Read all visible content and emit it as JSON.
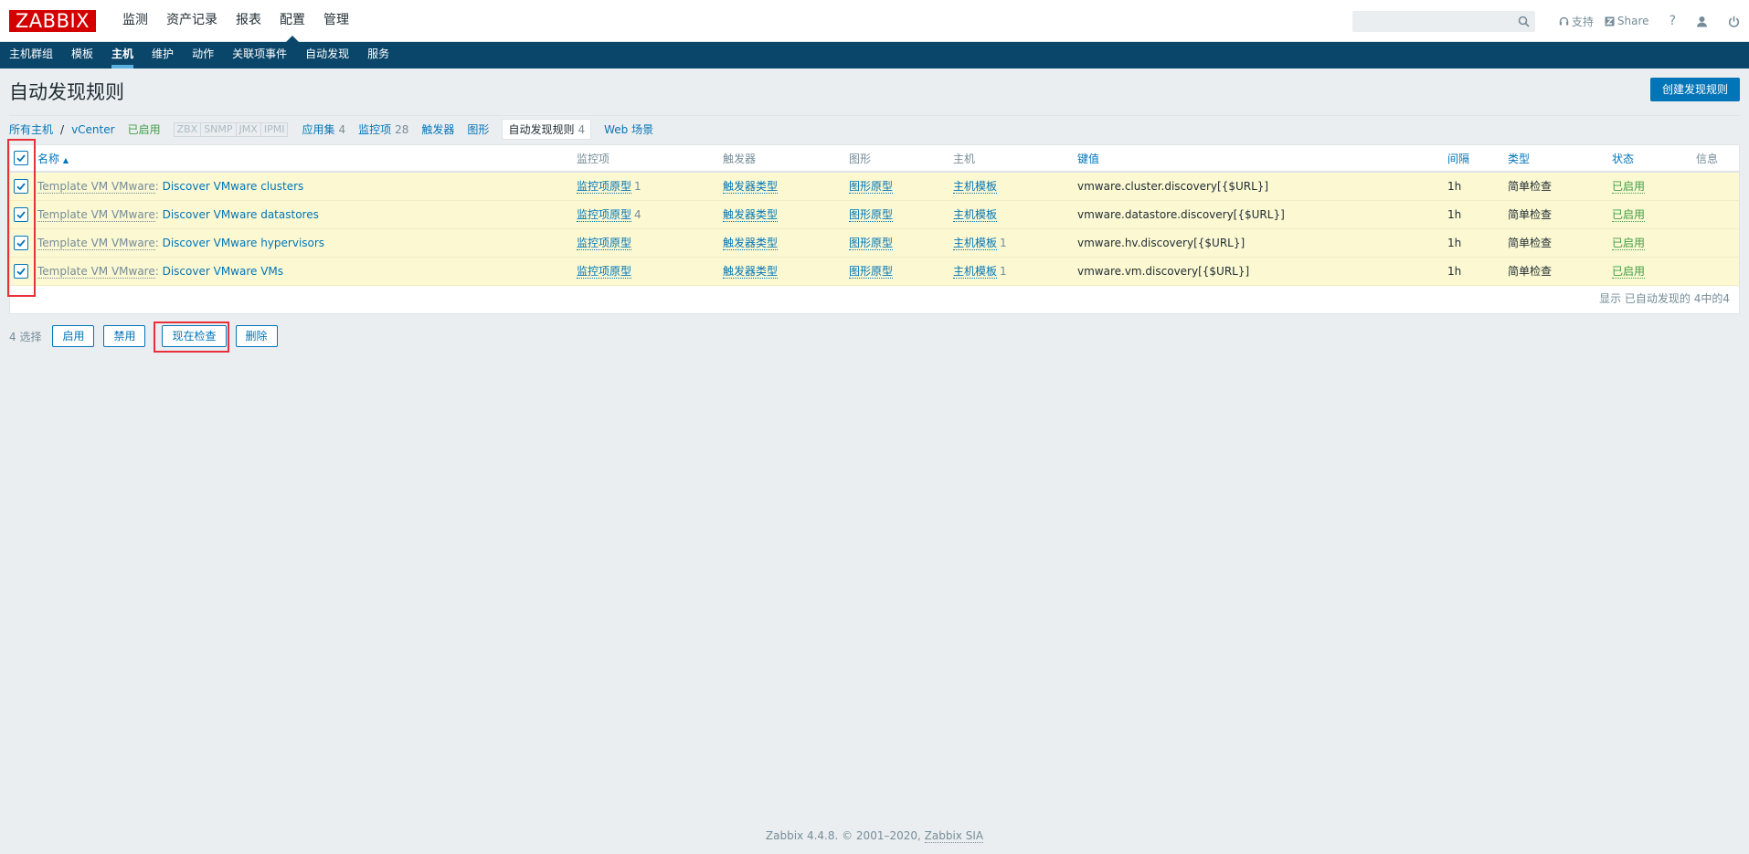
{
  "header": {
    "logo": "ZABBIX",
    "menu": [
      "监测",
      "资产记录",
      "报表",
      "配置",
      "管理"
    ],
    "active_menu": "配置",
    "support": "支持",
    "share": "Share",
    "help": "?"
  },
  "subnav": [
    "主机群组",
    "模板",
    "主机",
    "维护",
    "动作",
    "关联项事件",
    "自动发现",
    "服务"
  ],
  "page": {
    "title": "自动发现规则",
    "create_button": "创建发现规则"
  },
  "hostnav": {
    "all_hosts": "所有主机",
    "separator": "/",
    "host": "vCenter",
    "status": "已启用",
    "availability": [
      "ZBX",
      "SNMP",
      "JMX",
      "IPMI"
    ],
    "applications": "应用集",
    "applications_count": "4",
    "items": "监控项",
    "items_count": "28",
    "triggers": "触发器",
    "graphs": "图形",
    "discovery": "自动发现规则",
    "discovery_count": "4",
    "web": "Web 场景"
  },
  "table": {
    "headers": {
      "name": "名称",
      "sort_arrow": "▲",
      "items": "监控项",
      "triggers": "触发器",
      "graphs": "图形",
      "hosts": "主机",
      "key": "键值",
      "interval": "间隔",
      "type": "类型",
      "status": "状态",
      "info": "信息"
    },
    "rows": [
      {
        "template": "Template VM VMware",
        "colon": ":",
        "name": "Discover VMware clusters",
        "items": "监控项原型",
        "items_count": "1",
        "triggers": "触发器类型",
        "graphs": "图形原型",
        "hosts": "主机模板",
        "hosts_count": "",
        "key": "vmware.cluster.discovery[{$URL}]",
        "interval": "1h",
        "type": "简单检查",
        "status": "已启用"
      },
      {
        "template": "Template VM VMware",
        "colon": ":",
        "name": "Discover VMware datastores",
        "items": "监控项原型",
        "items_count": "4",
        "triggers": "触发器类型",
        "graphs": "图形原型",
        "hosts": "主机模板",
        "hosts_count": "",
        "key": "vmware.datastore.discovery[{$URL}]",
        "interval": "1h",
        "type": "简单检查",
        "status": "已启用"
      },
      {
        "template": "Template VM VMware",
        "colon": ":",
        "name": "Discover VMware hypervisors",
        "items": "监控项原型",
        "items_count": "",
        "triggers": "触发器类型",
        "graphs": "图形原型",
        "hosts": "主机模板",
        "hosts_count": "1",
        "key": "vmware.hv.discovery[{$URL}]",
        "interval": "1h",
        "type": "简单检查",
        "status": "已启用"
      },
      {
        "template": "Template VM VMware",
        "colon": ":",
        "name": "Discover VMware VMs",
        "items": "监控项原型",
        "items_count": "",
        "triggers": "触发器类型",
        "graphs": "图形原型",
        "hosts": "主机模板",
        "hosts_count": "1",
        "key": "vmware.vm.discovery[{$URL}]",
        "interval": "1h",
        "type": "简单检查",
        "status": "已启用"
      }
    ],
    "footer": "显示 已自动发现的 4中的4"
  },
  "actions": {
    "selected": "4 选择",
    "enable": "启用",
    "disable": "禁用",
    "check_now": "现在检查",
    "delete": "删除"
  },
  "footer": {
    "text": "Zabbix 4.4.8. © 2001–2020,",
    "link": "Zabbix SIA"
  },
  "colors": {
    "brand": "#d40000",
    "nav": "#0a466a",
    "link": "#0275b8",
    "row_highlight": "#fbf8d2",
    "enabled": "#429e47",
    "annotation": "#e8303b"
  }
}
